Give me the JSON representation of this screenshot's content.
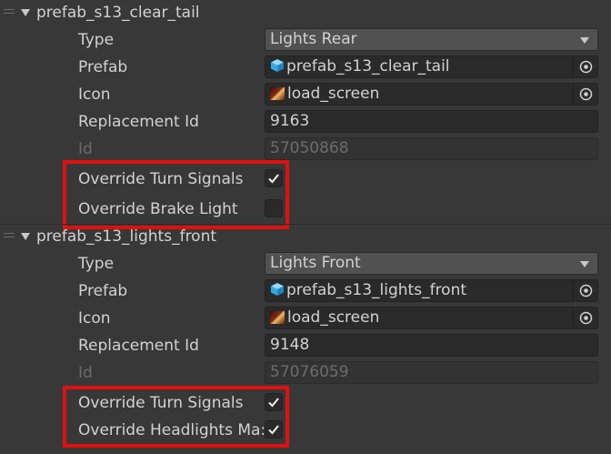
{
  "sections": [
    {
      "header": "prefab_s13_clear_tail",
      "type_label": "Type",
      "type_value": "Lights Rear",
      "prefab_label": "Prefab",
      "prefab_value": "prefab_s13_clear_tail",
      "icon_label": "Icon",
      "icon_value": "load_screen",
      "replacement_label": "Replacement Id",
      "replacement_value": "9163",
      "id_label": "Id",
      "id_value": "57050868",
      "checks": [
        {
          "label": "Override Turn Signals",
          "checked": true
        },
        {
          "label": "Override Brake Light",
          "checked": false
        }
      ]
    },
    {
      "header": "prefab_s13_lights_front",
      "type_label": "Type",
      "type_value": "Lights Front",
      "prefab_label": "Prefab",
      "prefab_value": "prefab_s13_lights_front",
      "icon_label": "Icon",
      "icon_value": "load_screen",
      "replacement_label": "Replacement Id",
      "replacement_value": "9148",
      "id_label": "Id",
      "id_value": "57076059",
      "checks": [
        {
          "label": "Override Turn Signals",
          "checked": true
        },
        {
          "label": "Override Headlights Ma:",
          "checked": true
        }
      ]
    }
  ],
  "icons": {
    "prefab": "prefab-cube-icon",
    "texture": "texture-thumbnail-icon",
    "picker": "object-picker-icon",
    "foldout": "foldout-arrow-icon",
    "drag": "drag-handle-icon",
    "check": "checkmark-icon"
  },
  "colors": {
    "background": "#383838",
    "field": "#2a2a2a",
    "dropdown": "#515151",
    "highlight": "#e01010",
    "prefab_icon": "#4fc3f7"
  }
}
